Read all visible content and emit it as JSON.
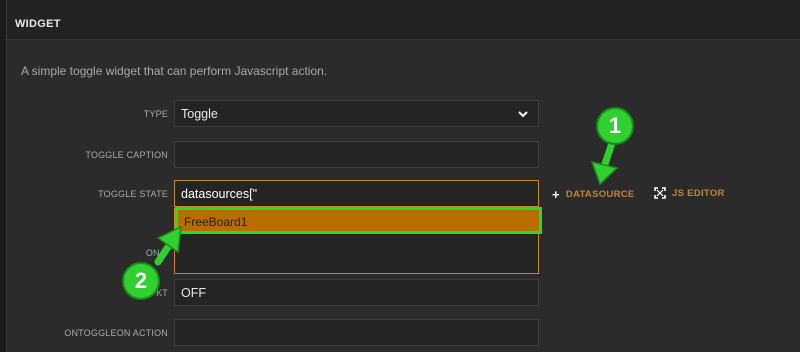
{
  "modal": {
    "title": "WIDGET",
    "description": "A simple toggle widget that can perform Javascript action."
  },
  "form": {
    "type": {
      "label": "TYPE",
      "value": "Toggle",
      "icon": "chevron-down-icon"
    },
    "toggle_caption": {
      "label": "TOGGLE CAPTION",
      "value": ""
    },
    "toggle_state": {
      "label": "TOGGLE STATE",
      "value": "datasources[\""
    },
    "on_text": {
      "label": "ON T",
      "value": ""
    },
    "off_text": {
      "label": "KT",
      "value": "OFF"
    },
    "ontoggleon_action": {
      "label": "ONTOGGLEON ACTION",
      "value": ""
    }
  },
  "autocomplete": {
    "items": [
      "FreeBoard1"
    ]
  },
  "actions": {
    "datasource": {
      "label": "DATASOURCE",
      "icon": "plus-icon"
    },
    "js_editor": {
      "label": "JS EDITOR",
      "icon": "expand-icon"
    }
  },
  "callouts": [
    "1",
    "2"
  ],
  "colors": {
    "accent": "#c4852d",
    "highlight_border": "#29d92b",
    "dropdown_bg": "#b86e00",
    "callout": "#2fd02f"
  }
}
